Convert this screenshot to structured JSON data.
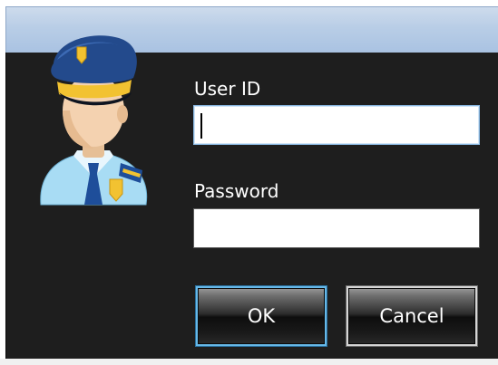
{
  "dialog": {
    "user_id_label": "User ID",
    "user_id_value": "",
    "password_label": "Password",
    "password_value": "",
    "ok_label": "OK",
    "cancel_label": "Cancel"
  },
  "icons": {
    "avatar": "police-officer-icon"
  },
  "colors": {
    "title_bar": "#b8cde6",
    "content_bg": "#1e1e1e",
    "label_text": "#ffffff",
    "focus_border": "#66b8e8"
  }
}
